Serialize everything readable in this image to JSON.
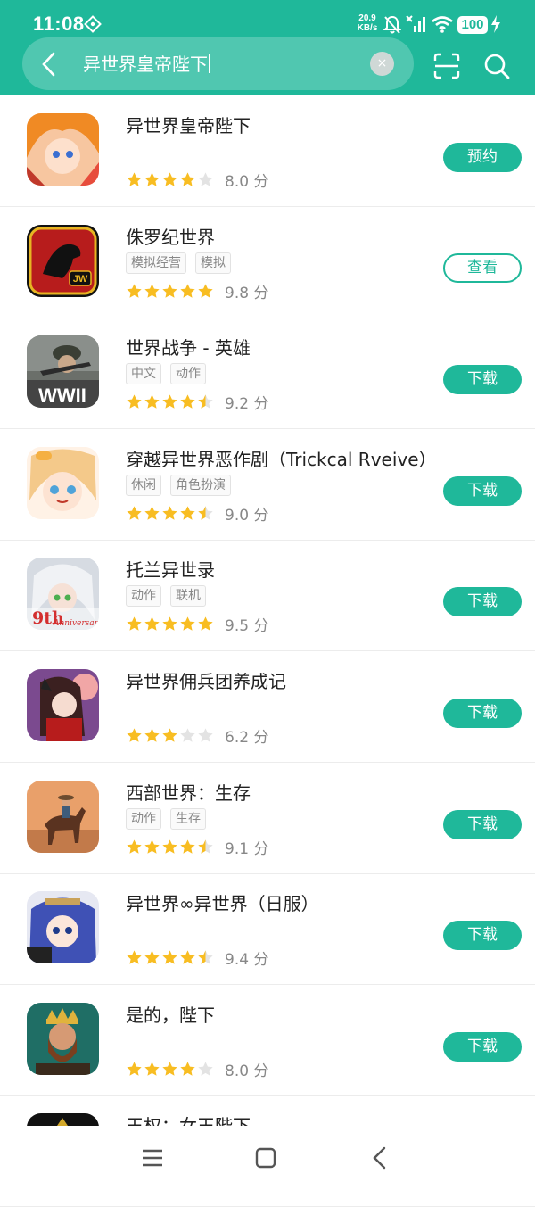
{
  "status": {
    "time": "11:08",
    "speed_value": "20.9",
    "speed_unit": "KB/s",
    "battery": "100"
  },
  "search": {
    "query": "异世界皇帝陛下",
    "clear_symbol": "×"
  },
  "colors": {
    "accent": "#1fb89a",
    "star": "#f8bd22",
    "star_empty": "#e3e3e3"
  },
  "apps": [
    {
      "name": "异世界皇帝陛下",
      "tags": [],
      "rating": 4,
      "score": "8.0 分",
      "action": "预约",
      "outline": false,
      "icon": "anime-girl-orange-hair-icon"
    },
    {
      "name": "侏罗纪世界",
      "tags": [
        "模拟经营",
        "模拟"
      ],
      "rating": 5,
      "score": "9.8 分",
      "action": "查看",
      "outline": true,
      "icon": "jurassic-world-logo-icon"
    },
    {
      "name": "世界战争 - 英雄",
      "tags": [
        "中文",
        "动作"
      ],
      "rating": 4.5,
      "score": "9.2 分",
      "action": "下载",
      "outline": false,
      "icon": "wwii-soldier-icon"
    },
    {
      "name": "穿越异世界恶作剧（Trickcal Rveive）",
      "tags": [
        "休闲",
        "角色扮演"
      ],
      "rating": 4.5,
      "score": "9.0 分",
      "action": "下载",
      "outline": false,
      "icon": "chibi-girl-icon"
    },
    {
      "name": "托兰异世录",
      "tags": [
        "动作",
        "联机"
      ],
      "rating": 5,
      "score": "9.5 分",
      "action": "下载",
      "outline": false,
      "icon": "white-hair-girl-icon"
    },
    {
      "name": "异世界佣兵团养成记",
      "tags": [],
      "rating": 3,
      "score": "6.2 分",
      "action": "下载",
      "outline": false,
      "icon": "dark-hair-girl-icon"
    },
    {
      "name": "西部世界：生存",
      "tags": [
        "动作",
        "生存"
      ],
      "rating": 4.5,
      "score": "9.1 分",
      "action": "下载",
      "outline": false,
      "icon": "cowboy-horse-icon"
    },
    {
      "name": "异世界∞异世界（日服）",
      "tags": [],
      "rating": 4.5,
      "score": "9.4 分",
      "action": "下载",
      "outline": false,
      "icon": "blue-hair-girl-icon"
    },
    {
      "name": "是的，陛下",
      "tags": [],
      "rating": 4,
      "score": "8.0 分",
      "action": "下载",
      "outline": false,
      "icon": "bearded-king-icon"
    },
    {
      "name": "王权：女王陛下",
      "tags": [],
      "rating": 0,
      "score": "",
      "action": "",
      "outline": false,
      "icon": "reigns-queen-icon"
    }
  ],
  "icon_labels": {
    "jw": "JW",
    "wwii": "WWII",
    "anniv_big": "9th",
    "anniv_small": "Anniversary"
  },
  "nav": {
    "menu_icon": "menu-icon",
    "home_icon": "home-icon",
    "back_icon": "back-icon"
  }
}
